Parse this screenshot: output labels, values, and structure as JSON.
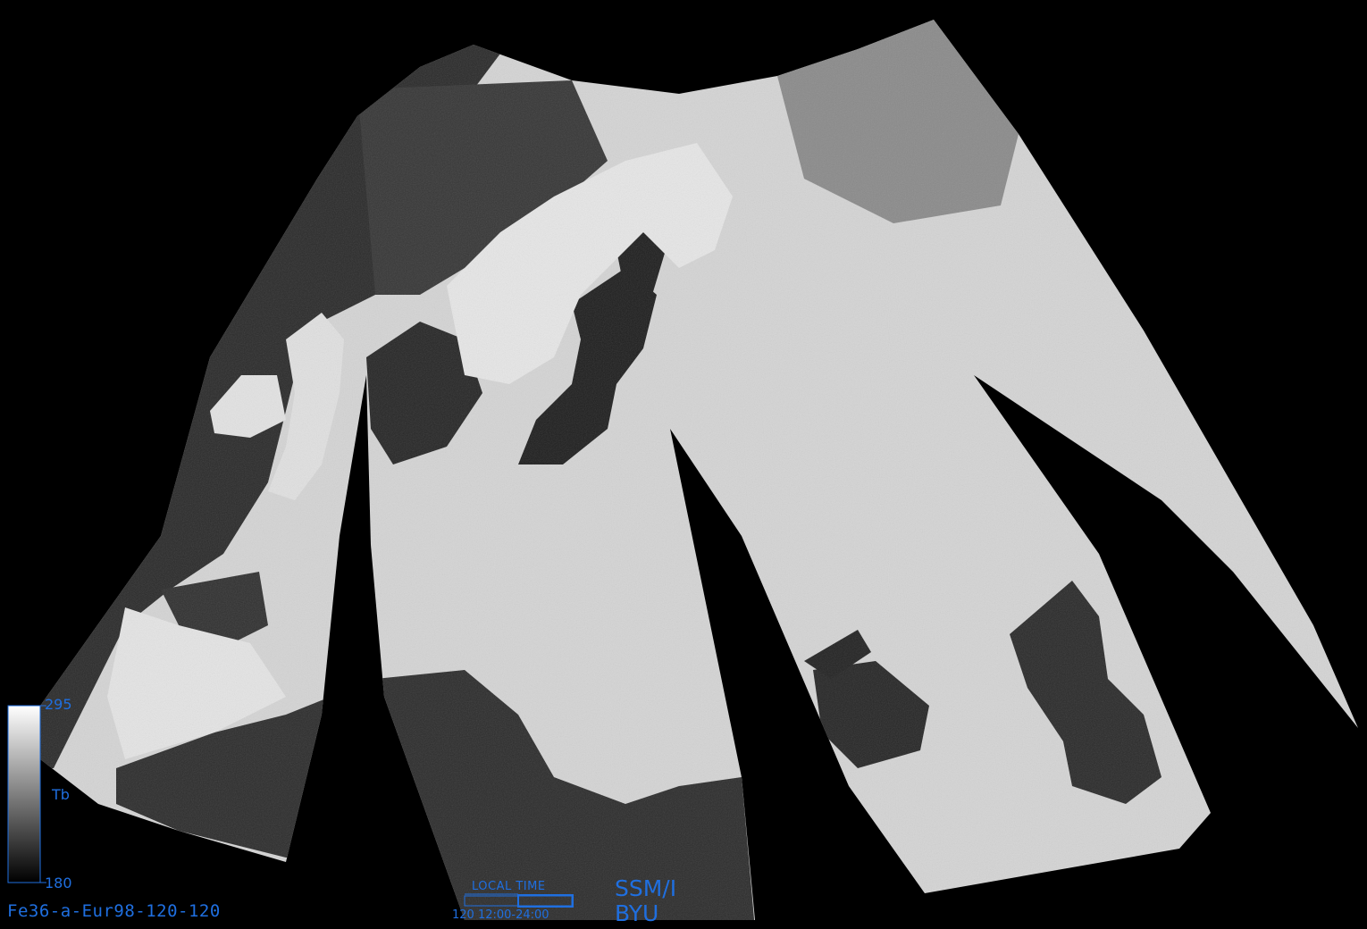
{
  "product_id": "Fe36-a-Eur98-120-120",
  "legend": {
    "max": "295",
    "min": "180",
    "variable": "Tb",
    "value_range": [
      180,
      295
    ]
  },
  "local_time": {
    "title": "LOCAL TIME",
    "range": "120 12:00-24:00"
  },
  "sensor": "SSM/I",
  "organization": "BYU",
  "colors": {
    "background": "#000000",
    "annotation": "#1f6fe0",
    "land_cold": "#d8d8d8",
    "sea_warm": "#1a1a1a"
  }
}
